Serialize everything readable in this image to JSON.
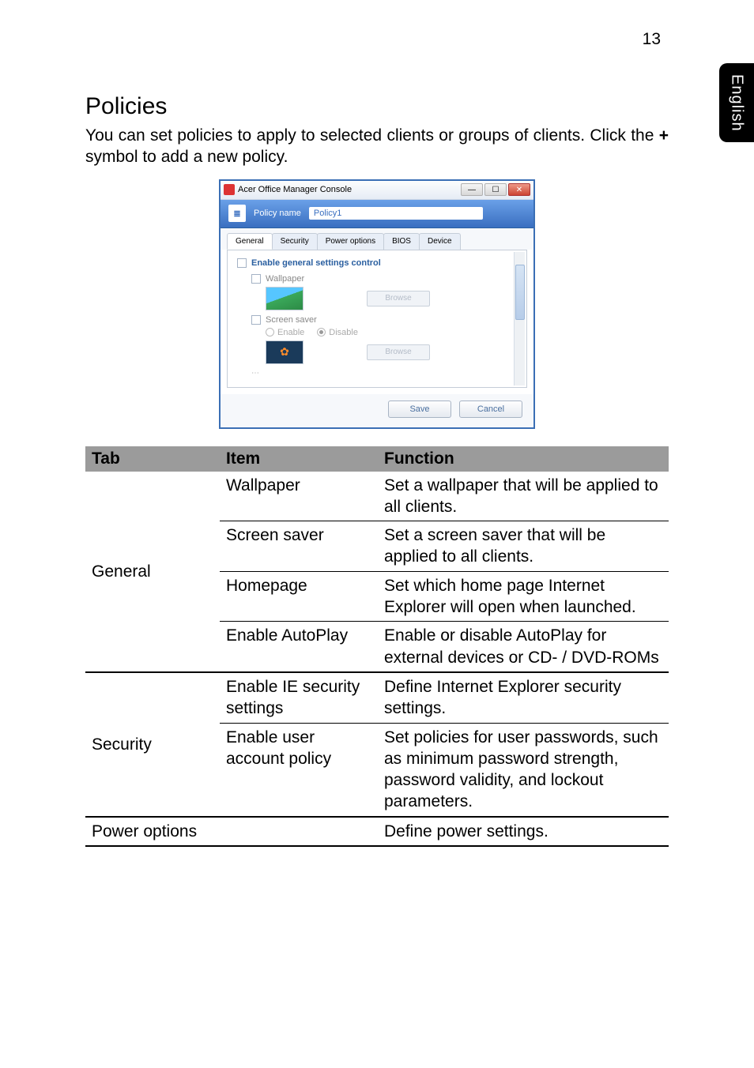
{
  "page_number": "13",
  "side_tab": "English",
  "heading": "Policies",
  "intro_text_1": "You can set policies to apply to selected clients or groups of clients. Click the ",
  "intro_plus": "+",
  "intro_text_2": " symbol to add a new policy.",
  "screenshot": {
    "title": "Acer Office Manager Console",
    "policy_name_label": "Policy name",
    "policy_name_value": "Policy1",
    "tabs": [
      "General",
      "Security",
      "Power options",
      "BIOS",
      "Device"
    ],
    "enable_general": "Enable general settings control",
    "wallpaper_label": "Wallpaper",
    "browse_label": "Browse",
    "screen_saver_label": "Screen saver",
    "radio_enable": "Enable",
    "radio_disable": "Disable",
    "save_label": "Save",
    "cancel_label": "Cancel"
  },
  "table": {
    "headers": {
      "tab": "Tab",
      "item": "Item",
      "function": "Function"
    },
    "groups": [
      {
        "tab": "General",
        "rows": [
          {
            "item": "Wallpaper",
            "function": "Set a wallpaper that will be applied to all clients."
          },
          {
            "item": "Screen saver",
            "function": "Set a screen saver that will be applied to all clients."
          },
          {
            "item": "Homepage",
            "function": "Set which home page Internet Explorer will open when launched."
          },
          {
            "item": "Enable AutoPlay",
            "function": "Enable or disable AutoPlay for external devices or CD- / DVD-ROMs"
          }
        ]
      },
      {
        "tab": "Security",
        "rows": [
          {
            "item": "Enable IE security settings",
            "function": "Define Internet Explorer security settings."
          },
          {
            "item": "Enable user account policy",
            "function": "Set policies for user passwords, such as minimum password strength, password validity, and lockout parameters."
          }
        ]
      },
      {
        "tab": "Power options",
        "rows": [
          {
            "item": "",
            "function": "Define power settings."
          }
        ]
      }
    ]
  }
}
